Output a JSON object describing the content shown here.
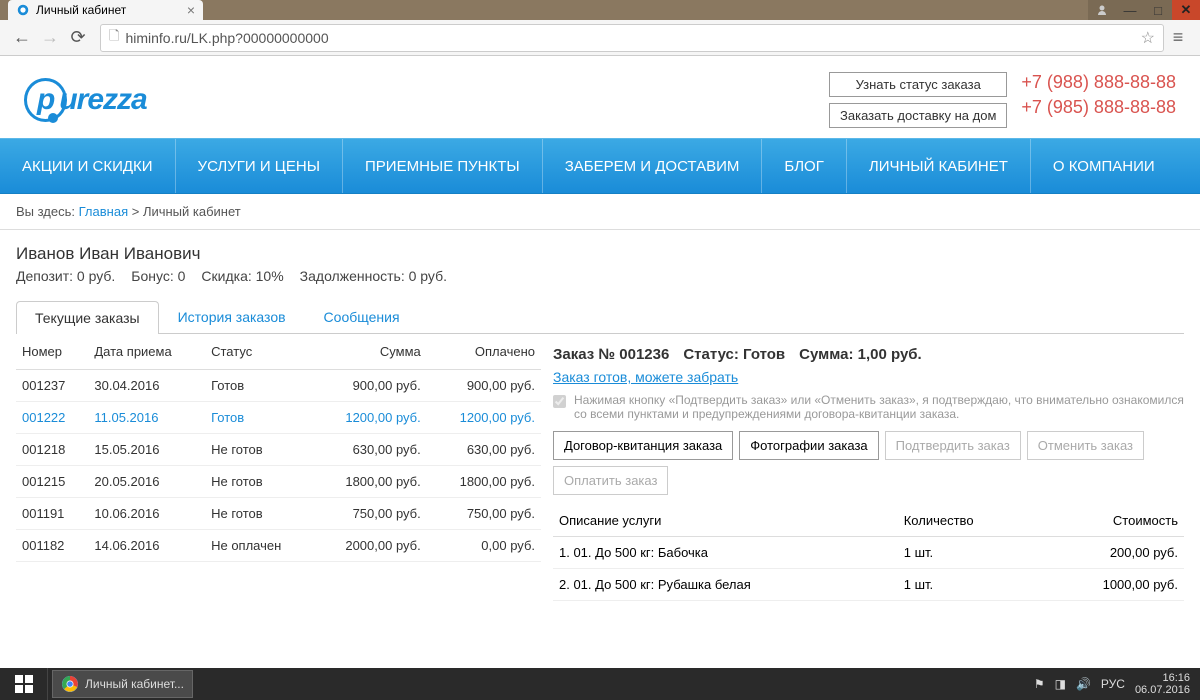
{
  "browser": {
    "tab_title": "Личный кабинет",
    "url": "himinfo.ru/LK.php?00000000000"
  },
  "header": {
    "logo_text": "purezza",
    "btn_status": "Узнать статус заказа",
    "btn_delivery": "Заказать доставку на дом",
    "phone1": "+7 (988) 888-88-88",
    "phone2": "+7 (985) 888-88-88"
  },
  "nav": {
    "items": [
      "АКЦИИ И СКИДКИ",
      "УСЛУГИ И ЦЕНЫ",
      "ПРИЕМНЫЕ ПУНКТЫ",
      "ЗАБЕРЕМ И ДОСТАВИМ",
      "БЛОГ",
      "ЛИЧНЫЙ КАБИНЕТ",
      "О КОМПАНИИ"
    ]
  },
  "breadcrumb": {
    "prefix": "Вы здесь:  ",
    "home": "Главная",
    "current": " > Личный кабинет"
  },
  "user": {
    "name": "Иванов Иван Иванович",
    "deposit": "Депозит: 0 руб.",
    "bonus": "Бонус: 0",
    "discount": "Скидка: 10%",
    "debt": "Задолженность: 0 руб."
  },
  "tabs": {
    "current": "Текущие заказы",
    "history": "История заказов",
    "messages": "Сообщения"
  },
  "orders": {
    "headers": {
      "num": "Номер",
      "date": "Дата приема",
      "status": "Статус",
      "sum": "Сумма",
      "paid": "Оплачено"
    },
    "rows": [
      {
        "num": "001237",
        "date": "30.04.2016",
        "status": "Готов",
        "sum": "900,00 руб.",
        "paid": "900,00 руб."
      },
      {
        "num": "001222",
        "date": "11.05.2016",
        "status": "Готов",
        "sum": "1200,00 руб.",
        "paid": "1200,00 руб."
      },
      {
        "num": "001218",
        "date": "15.05.2016",
        "status": "Не готов",
        "sum": "630,00 руб.",
        "paid": "630,00 руб."
      },
      {
        "num": "001215",
        "date": "20.05.2016",
        "status": "Не готов",
        "sum": "1800,00 руб.",
        "paid": "1800,00 руб."
      },
      {
        "num": "001191",
        "date": "10.06.2016",
        "status": "Не готов",
        "sum": "750,00 руб.",
        "paid": "750,00 руб."
      },
      {
        "num": "001182",
        "date": "14.06.2016",
        "status": "Не оплачен",
        "sum": "2000,00 руб.",
        "paid": "0,00 руб."
      }
    ]
  },
  "detail": {
    "order_label": "Заказ № 001236",
    "status_label": "Статус: Готов",
    "sum_label": "Сумма: 1,00 руб.",
    "ready_link": "Заказ готов, можете забрать",
    "disclaimer": "Нажимая кнопку «Подтвердить заказ» или «Отменить заказ», я подтверждаю, что внимательно ознакомился со всеми пунктами и предупреждениями договора-квитанции заказа.",
    "btn_contract": "Договор-квитанция заказа",
    "btn_photos": "Фотографии заказа",
    "btn_confirm": "Подтвердить заказ",
    "btn_cancel": "Отменить заказ",
    "btn_pay": "Оплатить заказ",
    "items_headers": {
      "desc": "Описание услуги",
      "qty": "Количество",
      "cost": "Стоимость"
    },
    "items": [
      {
        "desc": "1. 01. До 500 кг: Бабочка",
        "qty": "1 шт.",
        "cost": "200,00 руб."
      },
      {
        "desc": "2. 01. До 500 кг: Рубашка белая",
        "qty": "1 шт.",
        "cost": "1000,00 руб."
      }
    ]
  },
  "taskbar": {
    "task_label": "Личный кабинет...",
    "lang": "РУС",
    "time": "16:16",
    "date": "06.07.2016"
  }
}
